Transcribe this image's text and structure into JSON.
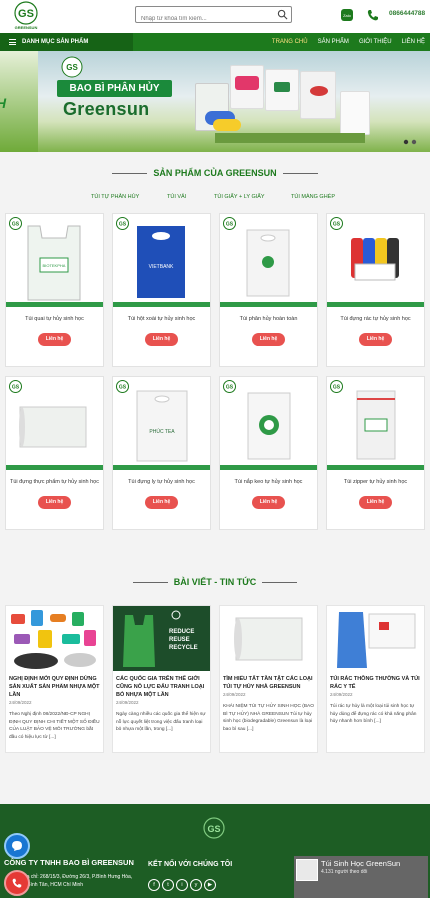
{
  "header": {
    "logo_text": "GS",
    "logo_sub": "GREENSUN",
    "search_placeholder": "Nhập từ khóa tìm kiếm...",
    "phone": "0866444788"
  },
  "nav": {
    "category_label": "DANH MỤC SẢN PHẨM",
    "menu": [
      {
        "label": "TRANG CHỦ",
        "active": true
      },
      {
        "label": "SẢN PHẨM",
        "active": false
      },
      {
        "label": "GIỚI THIỆU",
        "active": false
      },
      {
        "label": "LIÊN HỆ",
        "active": false
      }
    ]
  },
  "banner": {
    "strip_text": "H",
    "badge": "BAO BÌ PHÂN HỦY",
    "brand": "Greensun"
  },
  "products_section": {
    "title": "SẢN PHẨM CỦA GREENSUN",
    "tabs": [
      "TÚI TỰ PHÂN HỦY",
      "TÚI VẢI",
      "TÚI GIẤY + LY GIẤY",
      "TÚI MÀNG GHÉP"
    ],
    "items": [
      {
        "name": "Túi quai tự hủy sinh học",
        "button": "Liên hệ"
      },
      {
        "name": "Túi hột xoài tự hủy sinh học",
        "button": "Liên hệ"
      },
      {
        "name": "Túi phân hủy hoàn toàn",
        "button": "Liên hệ"
      },
      {
        "name": "Túi đựng rác tự hủy sinh học",
        "button": "Liên hệ"
      },
      {
        "name": "Túi đựng thực phẩm tự hủy sinh học",
        "button": "Liên hệ"
      },
      {
        "name": "Túi đựng ly tự hủy sinh học",
        "button": "Liên hệ"
      },
      {
        "name": "Túi nắp keo tự hủy sinh học",
        "button": "Liên hệ"
      },
      {
        "name": "Túi zipper tự hủy sinh học",
        "button": "Liên hệ"
      }
    ]
  },
  "blog_section": {
    "title": "BÀI VIẾT - TIN TỨC",
    "posts": [
      {
        "title": "NGHỊ ĐỊNH MỚI QUY ĐỊNH DỪNG SẢN XUẤT SẢN PHẨM NHỰA MỘT LẦN",
        "date": "24/09/2022",
        "excerpt": "Theo Nghị định 08/2022/NĐ-CP NGHỊ ĐỊNH QUY ĐỊNH CHI TIẾT MỘT SỐ ĐIỀU CỦA LUẬT BẢO VỆ MÔI TRƯỜNG bắt đầu có hiệu lực từ [...]"
      },
      {
        "title": "CÁC QUỐC GIA TRÊN THẾ GIỚI CŨNG NỖ LỰC ĐẤU TRANH LOẠI BỎ NHỰA MỘT LẦN",
        "date": "24/09/2022",
        "excerpt": "Ngày càng nhiều các quốc gia thể hiện sự nỗ lực quyết liệt trong việc đấu tranh loại bỏ nhựa một lần, trong [...]",
        "image_text": [
          "REDUCE",
          "REUSE",
          "RECYCLE"
        ]
      },
      {
        "title": "TÌM HIỂU TẤT TẦN TẬT CÁC LOẠI TÚI TỰ HỦY NHÀ GREENSUN",
        "date": "24/09/2022",
        "excerpt": "KHÁI NIỆM TÚI TỰ HỦY SINH HỌC (BAO BÌ TỰ HỦY) NHÀ GREENSUN Túi tự hủy sinh học (biodegradable) Greensun là loại bao bì sau [...]"
      },
      {
        "title": "TÚI RÁC THÔNG THƯỜNG VÀ TÚI RÁC Y TẾ",
        "date": "24/09/2022",
        "excerpt": "Túi rác tự hủy là một loại túi sinh học tự hủy dùng để đựng rác có khả năng phân hủy nhanh hơn bình [...]"
      }
    ]
  },
  "footer": {
    "company": "CÔNG TY TNHH BAO BÌ GREENSUN",
    "address": "Địa chỉ: 268/15/3, Đường 26/3, P.Bình Hưng Hòa, Q.Bình Tân, HCM Chí Minh",
    "connect_title": "KẾT NỐI VỚI CHÚNG TÔI",
    "social": [
      "f",
      "t",
      "i",
      "y",
      "▶"
    ],
    "fb_page": {
      "name": "Túi Sinh Học GreenSun",
      "followers": "4.131 người theo dõi"
    }
  }
}
